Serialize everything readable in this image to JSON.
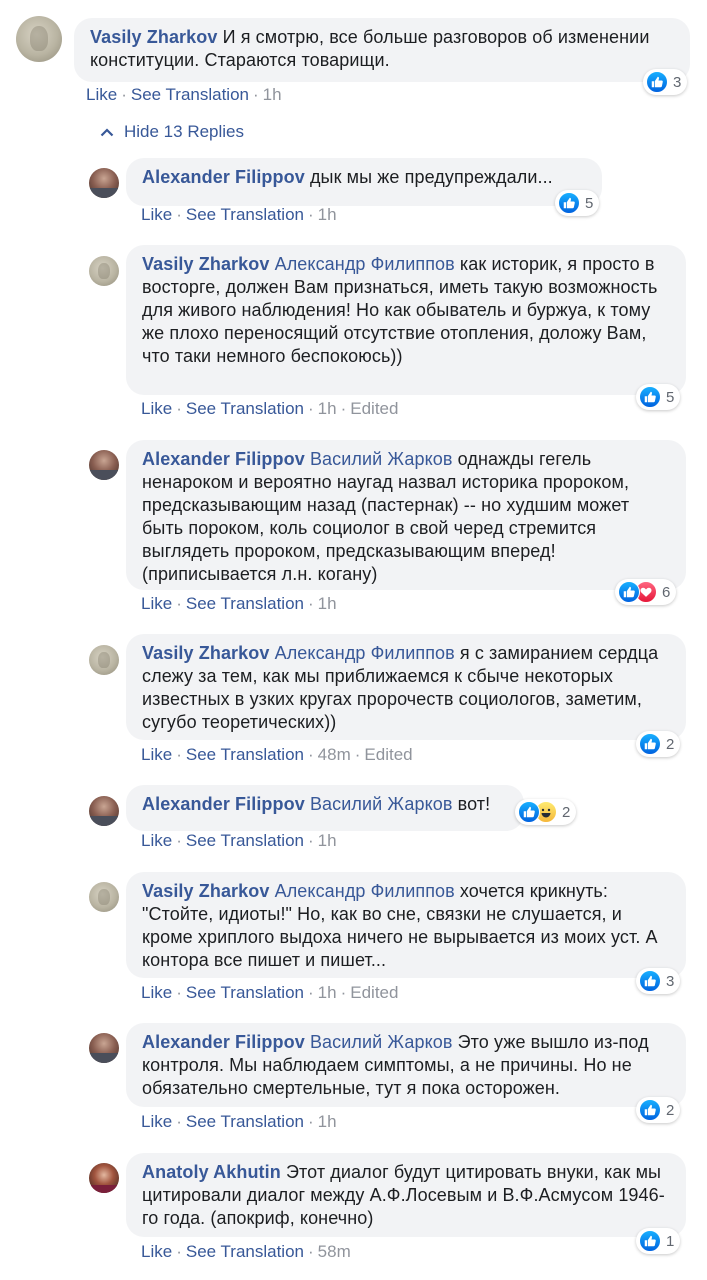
{
  "colors": {
    "link": "#385898",
    "meta_gray": "#90949c",
    "bubble_bg": "#f2f3f5",
    "like_blue": "#1877f2",
    "love_red": "#e61739"
  },
  "actions": {
    "like": "Like",
    "see_translation": "See Translation",
    "edited": "Edited",
    "separator": "·"
  },
  "top_comment": {
    "author": "Vasily Zharkov",
    "text": " И я смотрю, все больше разговоров об изменении конституции. Стараются товарищи.",
    "time": "1h",
    "reactions": [
      "like-icon"
    ],
    "reaction_count": "3"
  },
  "replies_toggle": {
    "label": "Hide 13 Replies",
    "icon": "chevron-up-icon"
  },
  "replies": [
    {
      "author": "Alexander Filippov",
      "mention": "",
      "text": " дык мы же предупреждали...",
      "time": "1h",
      "edited": false,
      "reactions": [
        "like-icon"
      ],
      "reaction_count": "5"
    },
    {
      "author": "Vasily Zharkov",
      "mention": " Александр Филиппов",
      "text": " как историк, я просто в восторге, должен Вам признаться, иметь такую возможность для живого наблюдения! Но как обыватель и буржуа, к тому же плохо переносящий отсутствие отопления, доложу Вам, что таки немного беспокоюсь))",
      "time": "1h",
      "edited": true,
      "reactions": [
        "like-icon"
      ],
      "reaction_count": "5"
    },
    {
      "author": "Alexander Filippov",
      "mention": " Василий Жарков",
      "text": " однажды гегель ненароком и вероятно наугад назвал историка пророком, предсказывающим назад (пастернак) -- но худшим может быть пороком, коль социолог в свой черед стремится выглядеть пророком, предсказывающим вперед! (приписывается л.н. когану)",
      "time": "1h",
      "edited": false,
      "reactions": [
        "like-icon",
        "love-icon"
      ],
      "reaction_count": "6"
    },
    {
      "author": "Vasily Zharkov",
      "mention": " Александр Филиппов",
      "text": " я с замиранием сердца слежу за тем, как мы приближаемся к сбыче некоторых известных в узких кругах пророчеств социологов, заметим, сугубо теоретических))",
      "time": "48m",
      "edited": true,
      "reactions": [
        "like-icon"
      ],
      "reaction_count": "2"
    },
    {
      "author": "Alexander Filippov",
      "mention": " Василий Жарков",
      "text": " вот!",
      "time": "1h",
      "edited": false,
      "reactions": [
        "like-icon",
        "haha-icon"
      ],
      "reaction_count": "2"
    },
    {
      "author": "Vasily Zharkov",
      "mention": " Александр Филиппов",
      "text": " хочется крикнуть: \"Стойте, идиоты!\" Но, как во сне, связки не слушается, и кроме хриплого выдоха ничего не вырывается из моих уст. А контора все пишет и пишет...",
      "time": "1h",
      "edited": true,
      "reactions": [
        "like-icon"
      ],
      "reaction_count": "3"
    },
    {
      "author": "Alexander Filippov",
      "mention": " Василий Жарков",
      "text": " Это уже вышло из-под контроля. Мы наблюдаем симптомы, а не причины. Но не обязательно смертельные, тут я пока осторожен.",
      "time": "1h",
      "edited": false,
      "reactions": [
        "like-icon"
      ],
      "reaction_count": "2"
    },
    {
      "author": "Anatoly Akhutin",
      "mention": "",
      "text": " Этот диалог будут цитировать внуки, как мы цитировали диалог между А.Ф.Лосевым и В.Ф.Асмусом 1946-го года. (апокриф, конечно)",
      "time": "58m",
      "edited": false,
      "reactions": [
        "like-icon"
      ],
      "reaction_count": "1"
    }
  ]
}
